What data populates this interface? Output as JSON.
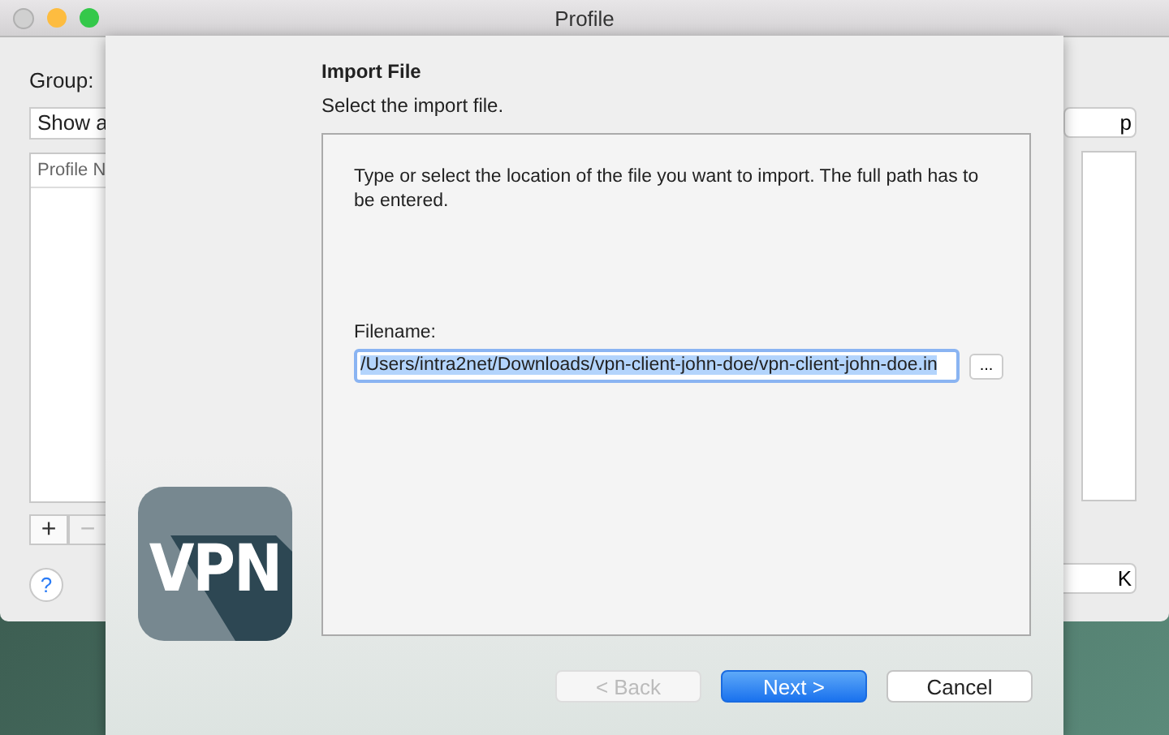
{
  "window": {
    "title": "Profile"
  },
  "background": {
    "group_label": "Group:",
    "group_select": "Show a",
    "right_button": "p",
    "table_header": "Profile N",
    "add": "+",
    "remove": "−",
    "help": "?",
    "ok_button": "K"
  },
  "sheet": {
    "title": "Import File",
    "subtitle": "Select the import file.",
    "instructions": "Type or select the location of the file you want to import. The full path has to be entered.",
    "filename_label": "Filename:",
    "filename_value": "/Users/intra2net/Downloads/vpn-client-john-doe/vpn-client-john-doe.in",
    "filename_selected": true,
    "browse": "...",
    "logo_text": "VPN",
    "buttons": [
      {
        "label": "< Back",
        "kind": "normal",
        "disabled": true
      },
      {
        "label": "Next >",
        "kind": "primary",
        "disabled": false
      },
      {
        "label": "Cancel",
        "kind": "normal",
        "disabled": false
      }
    ]
  }
}
